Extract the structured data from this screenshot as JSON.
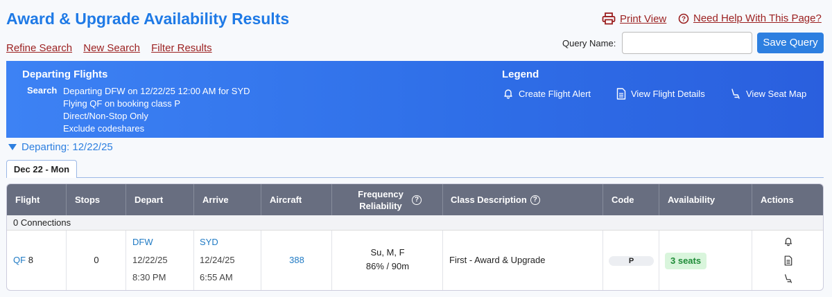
{
  "header": {
    "title": "Award & Upgrade Availability Results",
    "links": [
      "Refine Search",
      "New Search",
      "Filter Results"
    ],
    "print_view": "Print View",
    "help": "Need Help With This Page?",
    "query_label": "Query Name:",
    "query_value": "",
    "save_button": "Save Query"
  },
  "banner": {
    "title": "Departing Flights",
    "search_key": "Search",
    "search_lines": [
      "Departing DFW on 12/22/25 12:00 AM for SYD",
      "Flying QF on booking class P",
      "Direct/Non-Stop Only",
      "Exclude codeshares"
    ],
    "legend_title": "Legend",
    "legend": [
      {
        "icon": "bell-icon",
        "label": "Create Flight Alert"
      },
      {
        "icon": "document-icon",
        "label": "View Flight Details"
      },
      {
        "icon": "seat-icon",
        "label": "View Seat Map"
      }
    ]
  },
  "departing": "Departing: 12/22/25",
  "tab": "Dec 22 - Mon",
  "table": {
    "columns": [
      "Flight",
      "Stops",
      "Depart",
      "Arrive",
      "Aircraft",
      "Frequency Reliability",
      "Class Description",
      "Code",
      "Availability",
      "Actions"
    ],
    "connections_label": "0 Connections",
    "rows": [
      {
        "airline": "QF",
        "flight_num": "8",
        "stops": "0",
        "depart_airport": "DFW",
        "depart_date": "12/22/25",
        "depart_time": "8:30 PM",
        "arrive_airport": "SYD",
        "arrive_date": "12/24/25",
        "arrive_time": "6:55 AM",
        "aircraft": "388",
        "frequency": "Su, M, F",
        "reliability": "86% / 90m",
        "class_description": "First - Award & Upgrade",
        "code": "P",
        "availability": "3 seats"
      }
    ]
  },
  "colors": {
    "accent": "#2d7fe0",
    "link_red": "#9b1f1f",
    "header_gray": "#686e80",
    "available_green": "#1e8b37"
  }
}
